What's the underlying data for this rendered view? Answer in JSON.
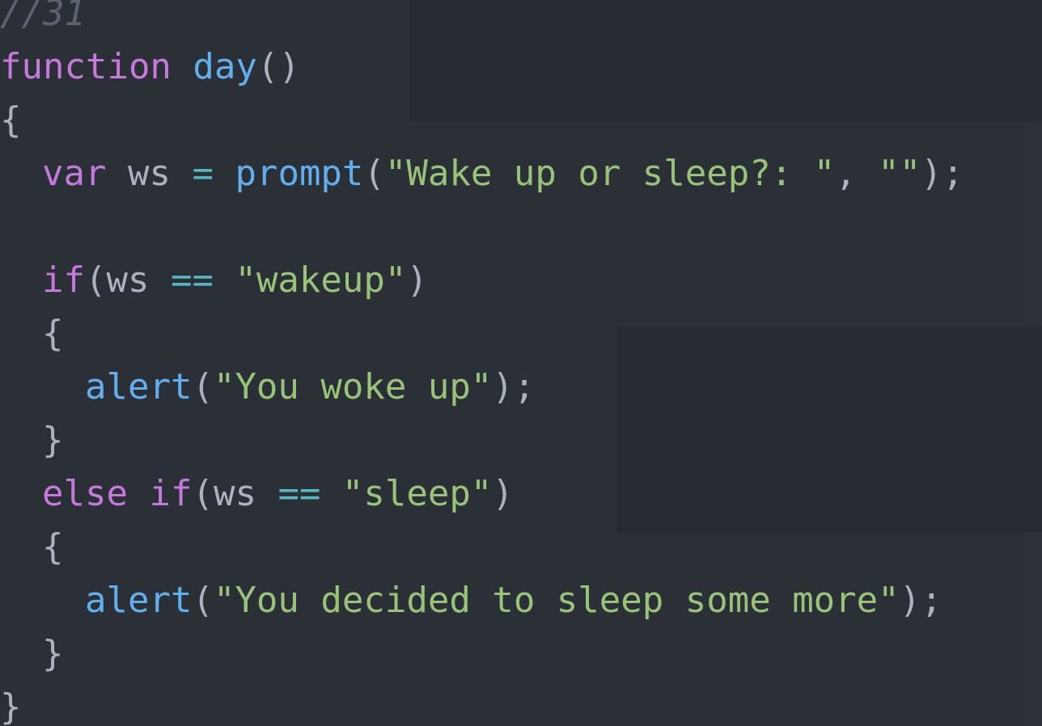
{
  "code": {
    "comment": "//31",
    "kw_function": "function",
    "fn_day": "day",
    "paren_empty": "()",
    "brace_open": "{",
    "brace_close": "}",
    "kw_var": "var",
    "ident_ws": "ws",
    "op_assign": "=",
    "fn_prompt": "prompt",
    "paren_open": "(",
    "str_prompt_msg": "\"Wake up or sleep?: \"",
    "comma": ",",
    "str_empty": "\"\"",
    "close_stmt": ");",
    "kw_if": "if",
    "op_eq": "==",
    "str_wakeup": "\"wakeup\"",
    "paren_close": ")",
    "fn_alert": "alert",
    "str_woke": "\"You woke up\"",
    "kw_else": "else",
    "str_sleep": "\"sleep\"",
    "str_sleep_more": "\"You decided to sleep some more\""
  },
  "theme": {
    "background": "#2b2f36",
    "keyword": "#c678dd",
    "function": "#61afef",
    "string": "#98c379",
    "operator": "#56b6c2",
    "comment": "#5c6370",
    "plain": "#abb2bf"
  }
}
